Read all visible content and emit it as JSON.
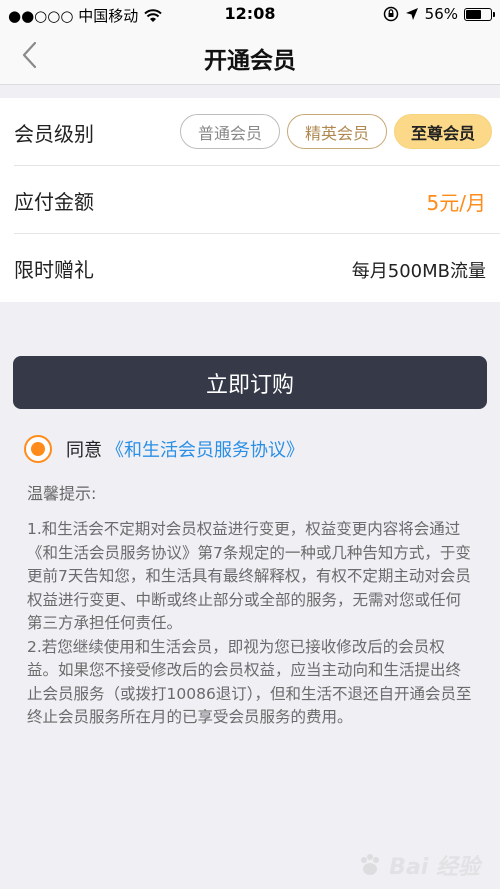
{
  "status_bar": {
    "carrier": "●●○○○ 中国移动",
    "time": "12:08",
    "battery": "56%",
    "battery_level": 0.56
  },
  "nav": {
    "title": "开通会员",
    "back_icon": "chevron-left-icon"
  },
  "form": {
    "level": {
      "label": "会员级别",
      "options": [
        "普通会员",
        "精英会员",
        "至尊会员"
      ],
      "selected": "至尊会员"
    },
    "amount": {
      "label": "应付金额",
      "value": "5元/月"
    },
    "gift": {
      "label": "限时赠礼",
      "value": "每月500MB流量"
    }
  },
  "buy_button": "立即订购",
  "agreement": {
    "prefix": "同意",
    "link": "《和生活会员服务协议》",
    "checked": true
  },
  "tips": {
    "title": "温馨提示:",
    "items": [
      "1.和生活会不定期对会员权益进行变更，权益变更内容将会通过《和生活会员服务协议》第7条规定的一种或几种告知方式，于变更前7天告知您，和生活具有最终解释权，有权不定期主动对会员权益进行变更、中断或终止部分或全部的服务，无需对您或任何第三方承担任何责任。",
      "2.若您继续使用和生活会员，即视为您已接收修改后的会员权益。如果您不接受修改后的会员权益，应当主动向和生活提出终止会员服务（或拨打10086退订），但和生活不退还自开通会员至终止会员服务所在月的已享受会员服务的费用。"
    ]
  },
  "watermark": "Bai 经验",
  "colors": {
    "accent": "#ff8c1a",
    "link": "#2a8fe6",
    "button": "#363a48",
    "selected_chip": "#fbd989"
  }
}
